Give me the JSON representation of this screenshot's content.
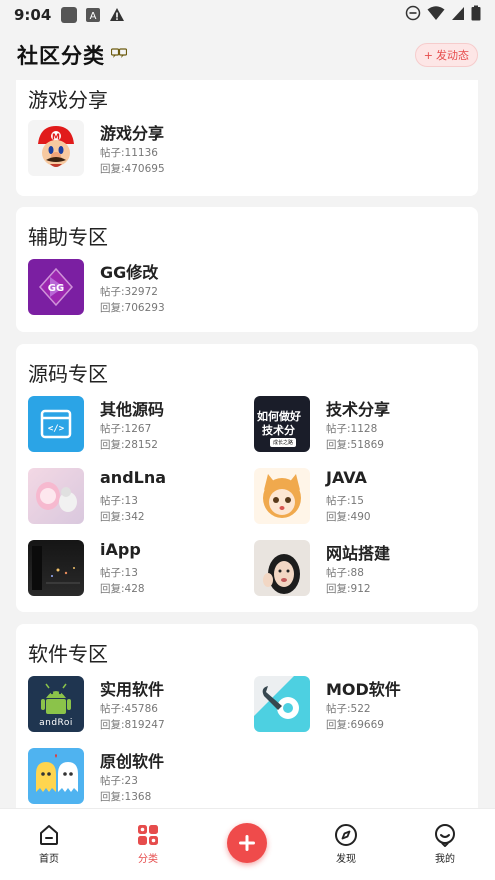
{
  "status_bar": {
    "time": "9:04"
  },
  "header": {
    "title": "社区分类",
    "post_button_label": "发动态"
  },
  "sections": [
    {
      "title": "游戏分享",
      "items": [
        {
          "name": "游戏分享",
          "posts": "帖子:11136",
          "replies": "回复:470695",
          "icon": "mario-thumbnail"
        }
      ]
    },
    {
      "title": "辅助专区",
      "items": [
        {
          "name": "GG修改",
          "posts": "帖子:32972",
          "replies": "回复:706293",
          "icon": "gg-logo-thumbnail"
        }
      ]
    },
    {
      "title": "源码专区",
      "items": [
        {
          "name": "其他源码",
          "posts": "帖子:1267",
          "replies": "回复:28152",
          "icon": "code-window-icon"
        },
        {
          "name": "技术分享",
          "posts": "帖子:1128",
          "replies": "回复:51869",
          "icon": "tech-share-thumbnail"
        },
        {
          "name": "andLna",
          "posts": "帖子:13",
          "replies": "回复:342",
          "icon": "anime-girl-thumbnail"
        },
        {
          "name": "JAVA",
          "posts": "帖子:15",
          "replies": "回复:490",
          "icon": "anime-cat-girl-thumbnail"
        },
        {
          "name": "iApp",
          "posts": "帖子:13",
          "replies": "回复:428",
          "icon": "night-city-thumbnail"
        },
        {
          "name": "网站搭建",
          "posts": "帖子:88",
          "replies": "回复:912",
          "icon": "person-photo-thumbnail"
        }
      ]
    },
    {
      "title": "软件专区",
      "items": [
        {
          "name": "实用软件",
          "posts": "帖子:45786",
          "replies": "回复:819247",
          "icon": "android-logo-thumbnail"
        },
        {
          "name": "MOD软件",
          "posts": "帖子:522",
          "replies": "回复:69669",
          "icon": "settings-wrench-thumbnail"
        },
        {
          "name": "原创软件",
          "posts": "帖子:23",
          "replies": "回复:1368",
          "icon": "ghost-thumbnail"
        }
      ]
    }
  ],
  "tech_thumb_text": {
    "line1": "如何做好",
    "line2": "技术分",
    "line3": "成长之路"
  },
  "android_thumb_text": "andRoi",
  "tabbar": {
    "tabs": [
      {
        "label": "首页",
        "icon": "home-icon"
      },
      {
        "label": "分类",
        "icon": "category-grid-icon"
      },
      {
        "label": "",
        "icon": "plus-icon"
      },
      {
        "label": "发现",
        "icon": "compass-icon"
      },
      {
        "label": "我的",
        "icon": "profile-icon"
      }
    ],
    "active": "分类",
    "accent": "#e64c4c"
  }
}
